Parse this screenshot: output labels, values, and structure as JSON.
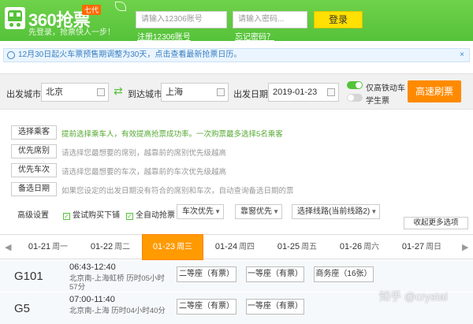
{
  "header": {
    "logo_text": "360抢票",
    "edition": "七代",
    "slogan": "先登录，抢票快人一步！",
    "username_placeholder": "请输入12306账号",
    "password_placeholder": "请输入密码...",
    "login_label": "登录",
    "register_link": "注册12306账号",
    "forgot_link": "忘记密码？"
  },
  "notice": {
    "text": "12月30日起火车票预售期调整为30天，点击查看最新抢票日历。",
    "close": "×"
  },
  "search": {
    "from_label": "出发城市",
    "from_value": "北京",
    "to_label": "到达城市",
    "to_value": "上海",
    "date_label": "出发日期",
    "date_value": "2019-01-23",
    "highspeed_label": "仅高铁动车",
    "student_label": "学生票",
    "refresh_label": "高速刷票",
    "swap_icon": "⇄"
  },
  "options": {
    "rows": [
      {
        "button": "选择乘客",
        "hint": "提前选择乘车人，有效提高抢票成功率。一次购票最多选择5名乘客"
      },
      {
        "button": "优先席别",
        "hint": "请选择您最想要的席别，越靠前的席别优先级越高"
      },
      {
        "button": "优先车次",
        "hint": "请选择您最想要的车次，越靠前的车次优先级越高"
      },
      {
        "button": "备选日期",
        "hint": "如果您设定的出发日期没有符合的席别和车次，自动查询备选日期的票"
      }
    ],
    "advanced_label": "高级设置",
    "try_buy_label": "尝试购买下铺",
    "auto_label": "全自动抢票",
    "train_priority": "车次优先",
    "window_priority": "靠窗优先",
    "route_select": "选择线路(当前线路2)",
    "collapse_label": "收起更多选项"
  },
  "dates": [
    {
      "date": "01-21",
      "weekday": "周一"
    },
    {
      "date": "01-22",
      "weekday": "周二"
    },
    {
      "date": "01-23",
      "weekday": "周三"
    },
    {
      "date": "01-24",
      "weekday": "周四"
    },
    {
      "date": "01-25",
      "weekday": "周五"
    },
    {
      "date": "01-26",
      "weekday": "周六"
    },
    {
      "date": "01-27",
      "weekday": "周日"
    }
  ],
  "active_date": "01-23",
  "trains": [
    {
      "number": "G101",
      "time": "06:43-12:40",
      "route": "北京南-上海虹桥 历时05小时",
      "duration_extra": "57分",
      "seats": [
        "二等座（有票）",
        "一等座（有票）",
        "商务座（16张）"
      ]
    },
    {
      "number": "G5",
      "time": "07:00-11:40",
      "route": "北京南-上海 历时04小时40分",
      "duration_extra": "",
      "seats": [
        "二等座（有票）",
        "一等座（有票）"
      ]
    }
  ],
  "watermark": "知乎 @crystal",
  "colors": {
    "brand_green": "#55c23a",
    "accent_orange": "#ff8a00",
    "login_yellow": "#ffe000"
  }
}
